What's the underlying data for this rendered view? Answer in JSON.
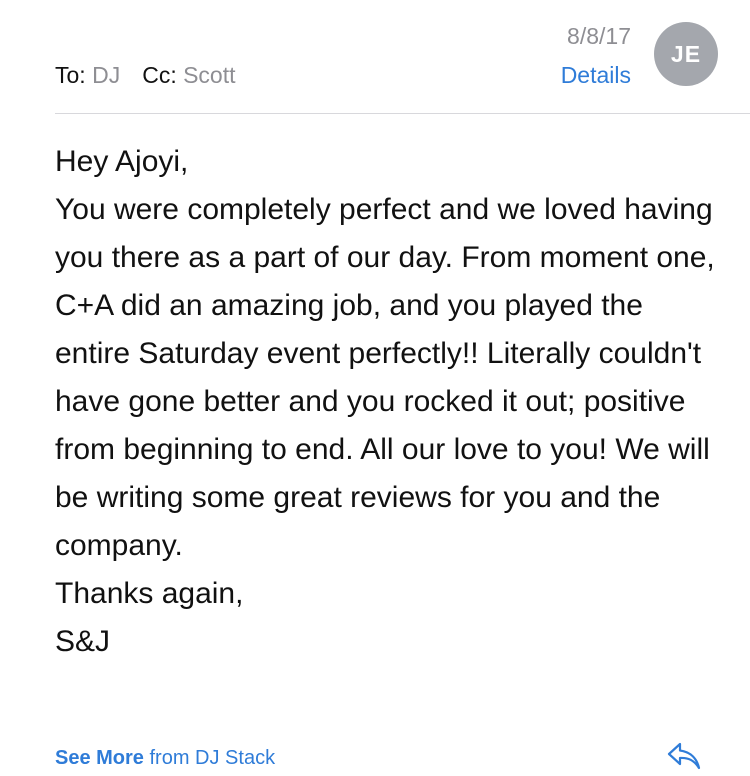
{
  "header": {
    "to_label": "To:",
    "to_value": "DJ",
    "cc_label": "Cc:",
    "cc_value": "Scott",
    "date": "8/8/17",
    "details_label": "Details",
    "avatar_initials": "JE"
  },
  "message": {
    "lines": [
      "Hey Ajoyi,",
      "You were completely perfect and we loved having you there as a part of our day. From moment one, C+A did an amazing job, and you played the entire Saturday event perfectly!! Literally couldn't have gone better and you rocked it out; positive from beginning to end. All our love to you! We will be writing some great reviews for you and the company.",
      "Thanks again,",
      "S&J"
    ]
  },
  "footer": {
    "see_more_label": "See More",
    "from_text": "from DJ Stack"
  },
  "icons": {
    "reply": "reply-arrow-icon"
  },
  "colors": {
    "accent": "#2f7cd8",
    "secondary_text": "#8e8e93",
    "avatar": "#a4a7ad"
  }
}
